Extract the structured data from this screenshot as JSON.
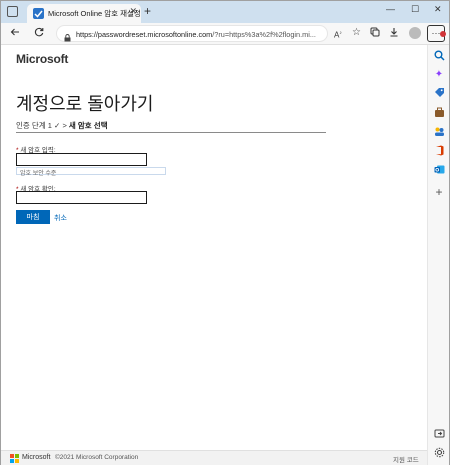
{
  "browser": {
    "tab_title": "Microsoft Online 암호 재설정",
    "tab_close": "✕",
    "new_tab": "+",
    "url_host": "https://passwordreset.microsoftonline.com",
    "url_path": "/?ru=https%3a%2f%2flogin.mi...",
    "minimize": "—",
    "maximize": "☐",
    "close": "✕"
  },
  "page": {
    "logo": "Microsoft",
    "heading": "계정으로 돌아가기",
    "steps": {
      "step1": "인증 단계 1",
      "check": "✓",
      "separator": ">",
      "current": "새 암호 선택"
    },
    "new_password": {
      "required_mark": "*",
      "label": "새 암호 입력:",
      "value": ""
    },
    "strength": "암호 보안 수준",
    "confirm_password": {
      "required_mark": "*",
      "label": "새 암호 확인:",
      "value": ""
    },
    "finish_button": "마침",
    "cancel_link": "취소"
  },
  "footer": {
    "brand": "Microsoft",
    "copyright": "©2021 Microsoft Corporation",
    "support_code": "지원 코드"
  },
  "colors": {
    "accent": "#0067b8",
    "required": "#a80000",
    "tabstrip": "#cfe0ef"
  },
  "icons": {
    "back": "arrow-left-icon",
    "refresh": "refresh-icon",
    "lock": "lock-icon",
    "read_aloud": "read-aloud-icon",
    "favorite": "star-icon",
    "collections": "collections-icon",
    "downloads": "download-icon",
    "extensions": "puzzle-icon"
  }
}
